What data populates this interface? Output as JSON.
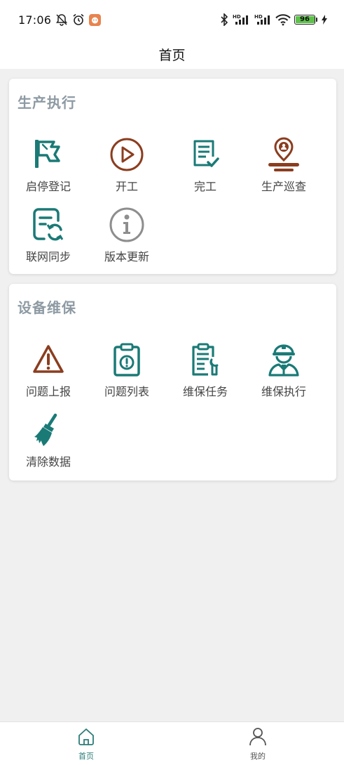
{
  "status_bar": {
    "time": "17:06",
    "icons": [
      "bell-off-icon",
      "alarm-icon",
      "app-notification-icon",
      "bluetooth-icon",
      "signal-hd-icon",
      "signal-hd-icon",
      "wifi-icon",
      "battery-icon",
      "charging-icon"
    ],
    "signal_label": "HD",
    "battery_level": "96",
    "battery_fraction": 0.96
  },
  "nav": {
    "title": "首页"
  },
  "colors": {
    "teal": "#1a7a76",
    "brown": "#8b3d1f",
    "gray": "#8e9aa3",
    "battery": "#5ec24a"
  },
  "sections": [
    {
      "title": "生产执行",
      "items": [
        {
          "label": "启停登记",
          "icon": "flag-icon"
        },
        {
          "label": "开工",
          "icon": "play-icon"
        },
        {
          "label": "完工",
          "icon": "checklist-icon"
        },
        {
          "label": "生产巡查",
          "icon": "location-person-icon"
        },
        {
          "label": "联网同步",
          "icon": "sync-document-icon"
        },
        {
          "label": "版本更新",
          "icon": "info-icon"
        }
      ]
    },
    {
      "title": "设备维保",
      "items": [
        {
          "label": "问题上报",
          "icon": "warning-icon"
        },
        {
          "label": "问题列表",
          "icon": "clipboard-alert-icon"
        },
        {
          "label": "维保任务",
          "icon": "clipboard-wrench-icon"
        },
        {
          "label": "维保执行",
          "icon": "worker-icon"
        },
        {
          "label": "清除数据",
          "icon": "broom-icon"
        }
      ]
    }
  ],
  "tab_bar": {
    "tabs": [
      {
        "label": "首页",
        "icon": "home-icon",
        "active": true
      },
      {
        "label": "我的",
        "icon": "user-icon",
        "active": false
      }
    ]
  }
}
